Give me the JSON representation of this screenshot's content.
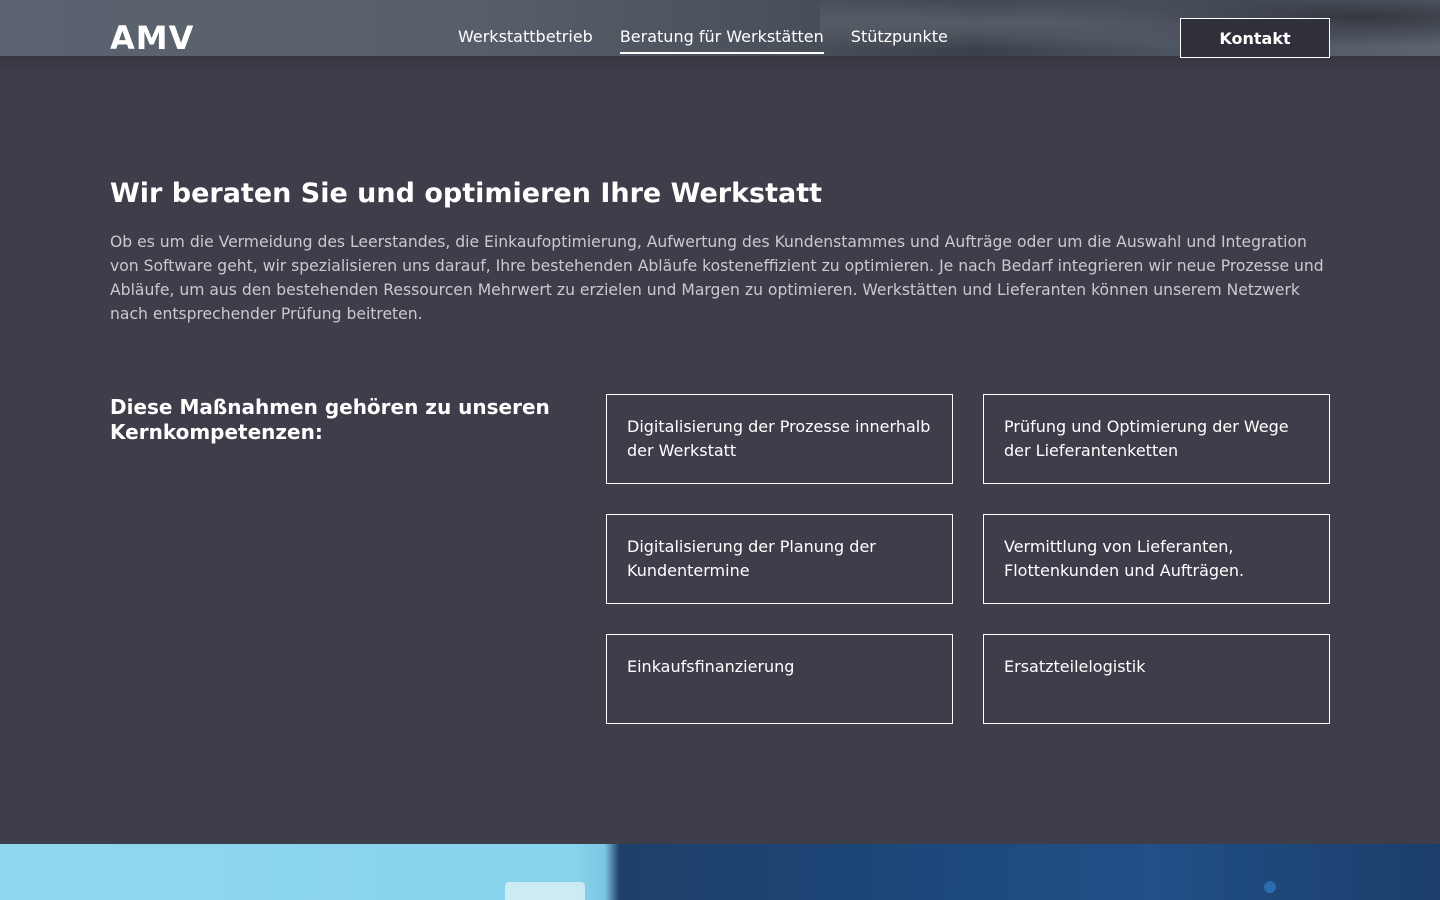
{
  "header": {
    "logo": "AMV",
    "nav": [
      {
        "label": "Werkstattbetrieb",
        "active": false
      },
      {
        "label": "Beratung für Werkstätten",
        "active": true
      },
      {
        "label": "Stützpunkte",
        "active": false
      }
    ],
    "contact_label": "Kontakt"
  },
  "main": {
    "title": "Wir beraten Sie und optimieren Ihre Werkstatt",
    "intro": "Ob es um die Vermeidung des Leerstandes, die Einkaufoptimierung, Aufwertung des Kundenstammes und Aufträge oder um die Auswahl und Integration von Software geht, wir spezialisieren uns darauf, Ihre bestehenden Abläufe kosteneffizient zu optimieren. Je nach Bedarf integrieren wir neue Prozesse und Abläufe, um aus den bestehenden Ressourcen Mehrwert zu erzielen und Margen zu optimieren. Werkstätten und Lieferanten können unserem Netzwerk nach entsprechender Prüfung beitreten.",
    "competencies_heading": "Diese Maßnahmen gehören zu unseren Kernkompetenzen:",
    "competencies": [
      "Digitalisierung der Prozesse innerhalb der Werkstatt",
      "Prüfung und Optimierung der Wege der Lieferantenketten",
      "Digitalisierung der Planung der Kundentermine",
      "Vermittlung von Lieferanten, Flottenkunden und Aufträgen.",
      "Einkaufsfinanzierung",
      "Ersatzteilelogistik"
    ]
  },
  "colors": {
    "background": "#3e3e4a",
    "text": "#ffffff",
    "body_text": "#c9c9cf"
  }
}
